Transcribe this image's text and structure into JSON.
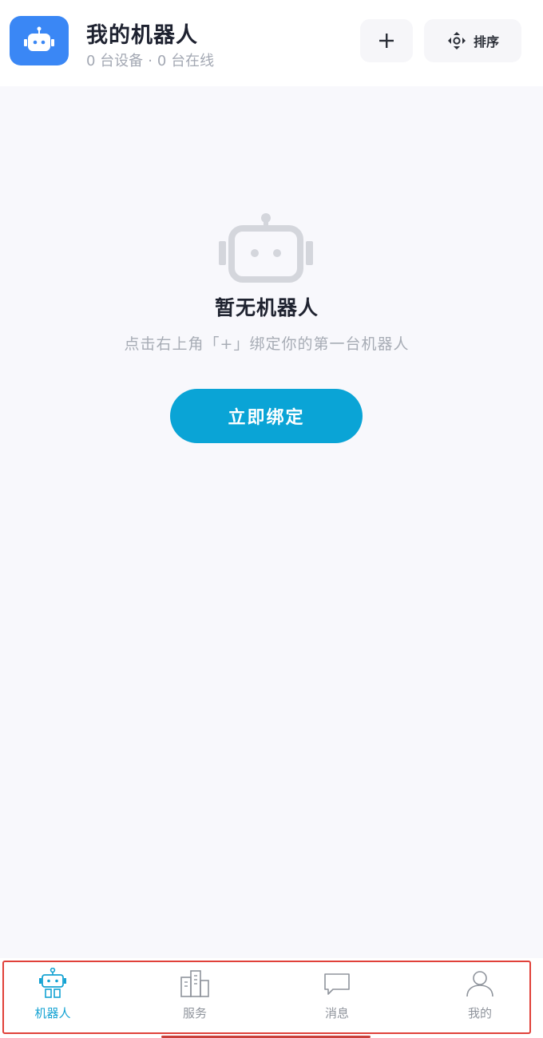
{
  "header": {
    "title": "我的机器人",
    "device_count": "0 台设备",
    "separator": "·",
    "online_count": "0 台在线",
    "add_label": "+",
    "sort_label": "排序"
  },
  "empty_state": {
    "title": "暂无机器人",
    "hint": "点击右上角「+」绑定你的第一台机器人",
    "button_label": "立即绑定"
  },
  "tabbar": {
    "items": [
      {
        "label": "机器人",
        "icon": "robot-icon",
        "active": true
      },
      {
        "label": "服务",
        "icon": "buildings-icon",
        "active": false
      },
      {
        "label": "消息",
        "icon": "chat-bubble-icon",
        "active": false
      },
      {
        "label": "我的",
        "icon": "user-icon",
        "active": false
      }
    ]
  },
  "colors": {
    "brand_blue": "#3a87f5",
    "accent_cyan": "#0aa4d6",
    "active_tab": "#15a3d3",
    "inactive_tab": "#8f949c",
    "background": "#f8f8fc"
  }
}
